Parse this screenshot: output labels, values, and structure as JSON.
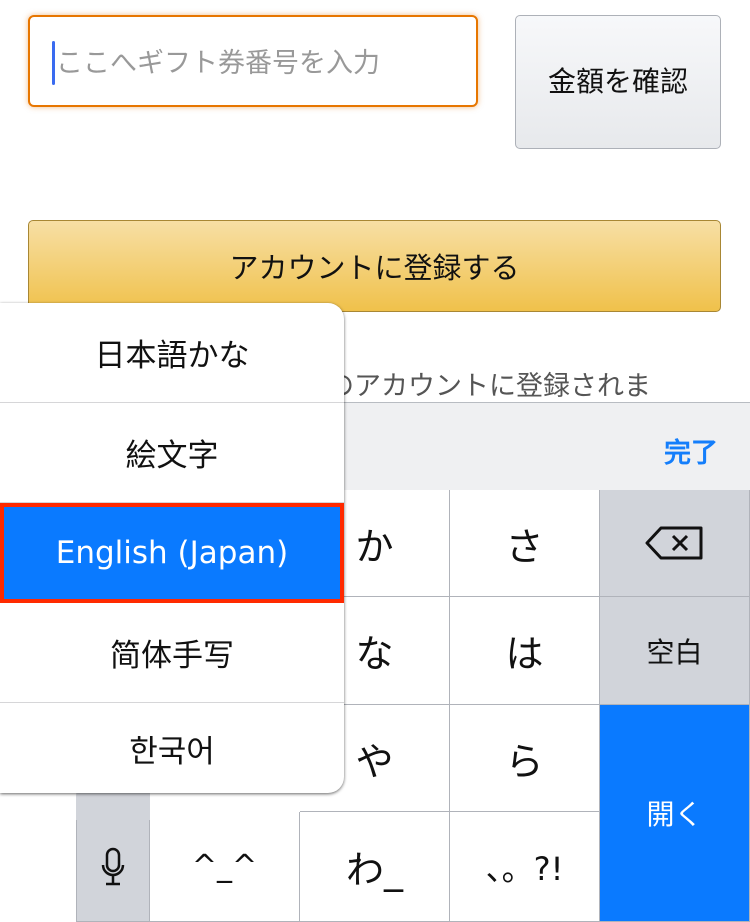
{
  "form": {
    "gift_input_placeholder": "ここへギフト券番号を入力",
    "check_amount_label": "金額を確認",
    "register_label": "アカウントに登録する",
    "note_text": "様のアカウントに登録されま"
  },
  "keyboard": {
    "done_label": "完了",
    "keys": {
      "ka": "か",
      "sa": "さ",
      "na": "な",
      "ha": "は",
      "ya": "や",
      "ra": "ら",
      "emoticon": "^_^",
      "wa": "わ_",
      "punct": "、。?!",
      "space": "空白",
      "return": "開く"
    },
    "colors": {
      "accent": "#0a7aff",
      "function_key": "#d1d4da"
    }
  },
  "language_menu": {
    "items": [
      "日本語かな",
      "絵文字",
      "English (Japan)",
      "简体手写",
      "한국어"
    ],
    "selected": "English (Japan)"
  },
  "colors": {
    "input_focus": "#e77600",
    "register_button": "#f0c14b",
    "selection_outline": "#ff2a00"
  }
}
